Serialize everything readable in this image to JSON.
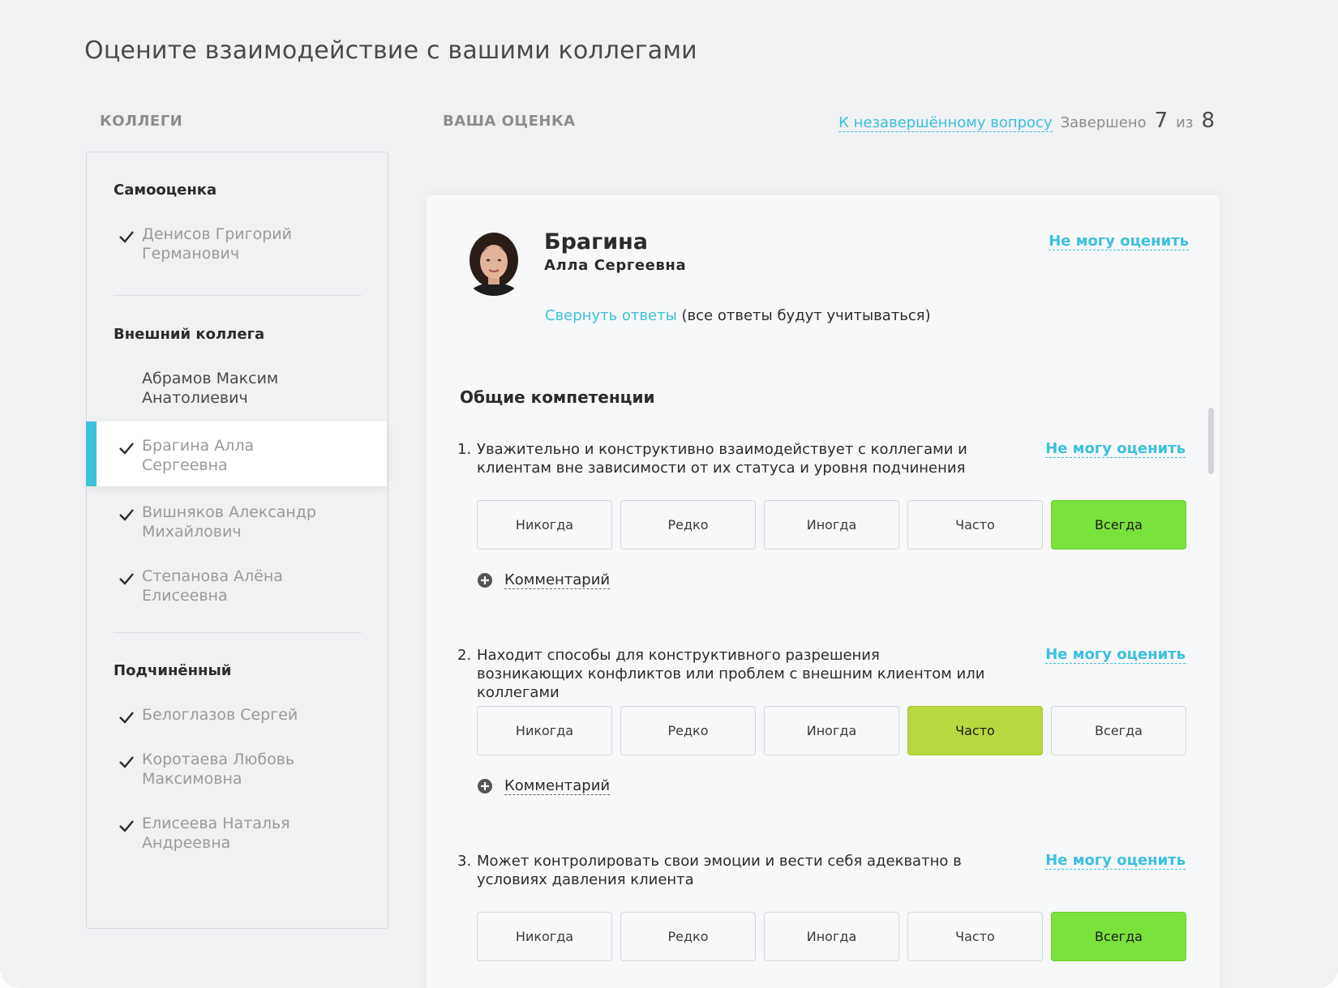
{
  "page_title": "Оцените взаимодействие с вашими коллегами",
  "columns": {
    "colleagues_label": "КОЛЛЕГИ",
    "rating_label": "ВАША ОЦЕНКА"
  },
  "header": {
    "unfinished_link": "К незавершённому вопросу",
    "completed_label": "Завершено",
    "completed_count": "7",
    "of_label": "из",
    "total_count": "8"
  },
  "sidebar": {
    "groups": [
      {
        "title": "Самооценка",
        "people": [
          {
            "line1": "Денисов Григорий",
            "line2": "Германович",
            "done": true
          }
        ]
      },
      {
        "title": "Внешний коллега",
        "people": [
          {
            "line1": "Абрамов Максим",
            "line2": "Анатолиевич",
            "done": false
          },
          {
            "line1": "Брагина Алла",
            "line2": "Сергеевна",
            "done": true,
            "active": true
          },
          {
            "line1": "Вишняков Александр",
            "line2": "Михайлович",
            "done": true
          },
          {
            "line1": "Степанова Алёна",
            "line2": "Елисеевна",
            "done": true
          }
        ]
      },
      {
        "title": "Подчинённый",
        "people": [
          {
            "line1": "Белоглазов Сергей",
            "line2": "",
            "done": true
          },
          {
            "line1": "Коротаева Любовь",
            "line2": "Максимовна",
            "done": true
          },
          {
            "line1": "Елисеева Наталья",
            "line2": "Андреевна",
            "done": true
          }
        ]
      }
    ]
  },
  "card": {
    "surname": "Брагина",
    "given_name": "Алла Сергеевна",
    "cant_rate": "Не могу оценить",
    "collapse_link": "Свернуть ответы",
    "collapse_note": " (все ответы будут учитываться)",
    "section_title": "Общие компетенции",
    "comment_label": "Комментарий",
    "options": [
      "Никогда",
      "Редко",
      "Иногда",
      "Часто",
      "Всегда"
    ],
    "questions": [
      {
        "num": "1.",
        "text": "Уважительно и конструктивно взаимодействует с коллегами и клиентам вне зависимости от их статуса и уровня подчинения",
        "selected": "Всегда"
      },
      {
        "num": "2.",
        "text": "Находит способы для конструктивного разрешения возникающих конфликтов или проблем с внешним клиентом или коллегами",
        "selected": "Часто"
      },
      {
        "num": "3.",
        "text": "Может контролировать свои эмоции и вести себя адекватно в условиях давления клиента",
        "selected": "Всегда"
      }
    ]
  },
  "colors": {
    "accent": "#3cc0de",
    "active_bar": "#3cc3db",
    "always": "#79e23b",
    "often": "#b7d83f"
  }
}
